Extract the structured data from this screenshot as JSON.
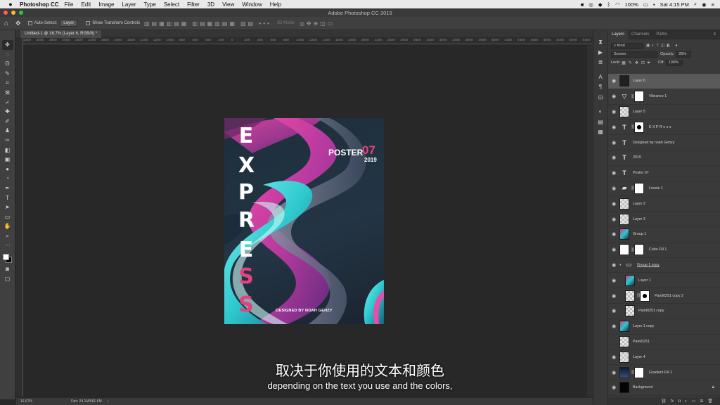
{
  "menubar": {
    "app": "Photoshop CC",
    "menus": [
      "File",
      "Edit",
      "Image",
      "Layer",
      "Type",
      "Select",
      "Filter",
      "3D",
      "View",
      "Window",
      "Help"
    ],
    "battery": "100%",
    "clock": "Sat 4:15 PM"
  },
  "window": {
    "title": "Adobe Photoshop CC 2019"
  },
  "options": {
    "auto_select_label": "Auto-Select:",
    "auto_select_value": "Layer",
    "transform_label": "Show Transform Controls",
    "mode_3d": "3D Mode:"
  },
  "document": {
    "tab": "Untitled-1 @ 16.7% (Layer 6, RGB/8) *",
    "zoom": "16.67%",
    "doc_size": "Doc: 24.1M/581.6M"
  },
  "ruler_ticks": [
    "3200",
    "3000",
    "2800",
    "2600",
    "2400",
    "2200",
    "2000",
    "1800",
    "1600",
    "1400",
    "1200",
    "1000",
    "800",
    "600",
    "400",
    "200",
    "0",
    "200",
    "400",
    "600",
    "800",
    "1000",
    "1200",
    "1400",
    "1600",
    "1800",
    "2000",
    "2200",
    "2400",
    "2600",
    "2800",
    "3000",
    "3200",
    "3400",
    "3600",
    "3800",
    "4000",
    "4200",
    "4400",
    "4600",
    "4800",
    "5000",
    "5200",
    "5400"
  ],
  "poster": {
    "letters": [
      "E",
      "X",
      "P",
      "R",
      "E",
      "S",
      "S"
    ],
    "title": "POSTER",
    "number": "07",
    "year": "2019",
    "credit": "DESIGNED BY NOAH GEHZY"
  },
  "subtitles": {
    "chinese": "取决于你使用的文本和颜色",
    "english": "depending on the text you use and the colors,"
  },
  "panel": {
    "tabs": [
      "Layers",
      "Channels",
      "Paths"
    ],
    "filter_kind": "Kind",
    "blend_mode": "Screen",
    "opacity_label": "Opacity:",
    "opacity_value": "25%",
    "lock_label": "Lock:",
    "fill_label": "Fill:",
    "fill_value": "100%"
  },
  "layers": [
    {
      "name": "Layer 6",
      "thumb": "dark",
      "selected": true
    },
    {
      "name": "Vibrance 1",
      "thumb": "adj",
      "adj_glyph": "▽",
      "mask": "white"
    },
    {
      "name": "Layer 5",
      "thumb": "check"
    },
    {
      "name": "E X P R e s s",
      "thumb": "type",
      "mask": "black"
    },
    {
      "name": "Designed by noah Gehzy",
      "thumb": "type"
    },
    {
      "name": "2019",
      "thumb": "type"
    },
    {
      "name": "Poster 07",
      "thumb": "type"
    },
    {
      "name": "Levels 1",
      "thumb": "adj",
      "adj_glyph": "▰",
      "mask": "white"
    },
    {
      "name": "Layer 2",
      "thumb": "check"
    },
    {
      "name": "Layer 3",
      "thumb": "check"
    },
    {
      "name": "Group 1",
      "thumb": "swirl"
    },
    {
      "name": "Color Fill 1",
      "thumb": "white",
      "mask": "white"
    },
    {
      "name": "Group 1 copy",
      "thumb": "folder",
      "group": true
    },
    {
      "name": "Layer 1",
      "thumb": "swirl",
      "indent": true
    },
    {
      "name": "Paint0251 copy 2",
      "thumb": "check",
      "mask": "black",
      "indent": true
    },
    {
      "name": "Paint0251 copy",
      "thumb": "check",
      "indent": true
    },
    {
      "name": "Layer 1 copy",
      "thumb": "swirl"
    },
    {
      "name": "Paint0251",
      "thumb": "check",
      "hidden": true
    },
    {
      "name": "Layer 4",
      "thumb": "check"
    },
    {
      "name": "Gradient Fill 1",
      "thumb": "grad",
      "mask": "white"
    },
    {
      "name": "Background",
      "thumb": "black",
      "locked": true
    }
  ]
}
